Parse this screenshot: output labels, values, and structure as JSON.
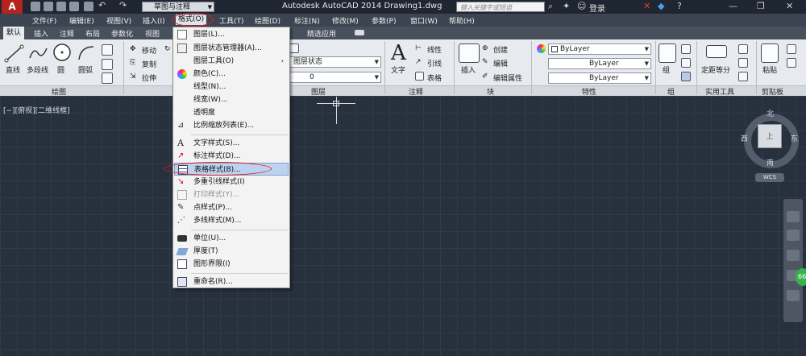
{
  "window": {
    "workspace": "草图与注释",
    "title": "Autodesk AutoCAD 2014    Drawing1.dwg",
    "search_placeholder": "键入关键字或短语",
    "login": "登录"
  },
  "menubar": [
    "文件(F)",
    "编辑(E)",
    "视图(V)",
    "插入(I)",
    "格式(O)",
    "工具(T)",
    "绘图(D)",
    "标注(N)",
    "修改(M)",
    "参数(P)",
    "窗口(W)",
    "帮助(H)"
  ],
  "tabs": [
    "默认",
    "插入",
    "注释",
    "布局",
    "参数化",
    "视图",
    "精选应用"
  ],
  "ribbon": {
    "draw": {
      "line": "直线",
      "polyline": "多段线",
      "circle": "圆",
      "arc": "圆弧",
      "panel": "绘图"
    },
    "modify": {
      "move": "移动",
      "copy": "复制",
      "stretch": "拉伸"
    },
    "layers": {
      "state": "图层状态",
      "layer_value": "0",
      "panel": "图层"
    },
    "annotation": {
      "text": "文字",
      "linear": "线性",
      "leader": "引线",
      "table": "表格",
      "panel": "注释"
    },
    "block": {
      "insert": "插入",
      "create": "创建",
      "edit": "编辑",
      "edit_attr": "编辑属性",
      "panel": "块"
    },
    "properties": {
      "color": "ByLayer",
      "linetype": "ByLayer",
      "lineweight": "ByLayer",
      "panel": "特性"
    },
    "groups": {
      "group": "组",
      "panel": "组"
    },
    "utilities": {
      "measure": "定距等分",
      "panel": "实用工具"
    },
    "clipboard": {
      "paste": "粘贴",
      "panel": "剪贴板"
    }
  },
  "viewport": {
    "label": "[−][俯视][二维线框]",
    "compass": {
      "north": "北",
      "south": "南",
      "east": "东",
      "west": "西",
      "top": "上"
    },
    "wcs": "WCS",
    "badge": "66"
  },
  "format_menu": {
    "items": [
      {
        "label": "图层(L)...",
        "icon": "layer-icon",
        "disabled": false
      },
      {
        "label": "图层状态管理器(A)...",
        "icon": "layer-state-icon",
        "disabled": false
      },
      {
        "label": "图层工具(O)",
        "icon": "",
        "disabled": false,
        "submenu": true
      },
      {
        "label": "颜色(C)...",
        "icon": "color-wheel-icon",
        "disabled": false
      },
      {
        "label": "线型(N)...",
        "icon": "",
        "disabled": false
      },
      {
        "label": "线宽(W)...",
        "icon": "",
        "disabled": false
      },
      {
        "label": "透明度",
        "icon": "",
        "disabled": false
      },
      {
        "label": "比例缩放列表(E)...",
        "icon": "scale-list-icon",
        "disabled": false
      },
      {
        "label": "文字样式(S)...",
        "icon": "text-style-icon",
        "disabled": false
      },
      {
        "label": "标注样式(D)...",
        "icon": "dim-style-icon",
        "disabled": false
      },
      {
        "label": "表格样式(B)...",
        "icon": "table-style-icon",
        "disabled": false,
        "highlighted": true
      },
      {
        "label": "多重引线样式(I)",
        "icon": "mleader-style-icon",
        "disabled": false
      },
      {
        "label": "打印样式(Y)...",
        "icon": "plot-style-icon",
        "disabled": true
      },
      {
        "label": "点样式(P)...",
        "icon": "point-style-icon",
        "disabled": false
      },
      {
        "label": "多线样式(M)...",
        "icon": "mline-style-icon",
        "disabled": false
      },
      {
        "label": "单位(U)...",
        "icon": "units-icon",
        "disabled": false
      },
      {
        "label": "厚度(T)",
        "icon": "thickness-icon",
        "disabled": false
      },
      {
        "label": "图形界限(I)",
        "icon": "limits-icon",
        "disabled": false
      },
      {
        "label": "重命名(R)...",
        "icon": "rename-icon",
        "disabled": false
      }
    ]
  },
  "colors": {
    "accent_highlight": "#e02020",
    "menu_selected": "#bcd2ee"
  }
}
